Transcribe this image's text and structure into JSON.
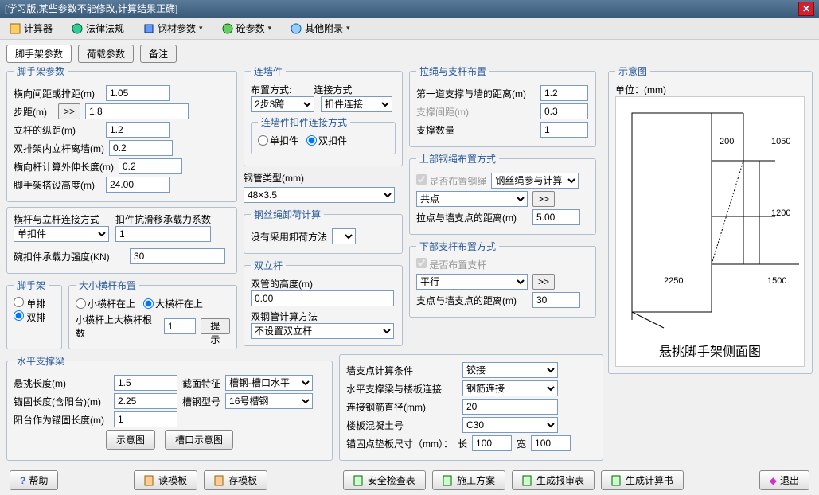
{
  "window": {
    "title": "[学习版,某些参数不能修改,计算结果正确]"
  },
  "toolbar": {
    "calc": "计算器",
    "law": "法律法规",
    "steel": "钢材参数",
    "concrete": "砼参数",
    "other": "其他附录"
  },
  "tabs": {
    "t1": "脚手架参数",
    "t2": "荷载参数",
    "t3": "备注"
  },
  "g_scaffold": {
    "legend": "脚手架参数",
    "l_hgap": "横向间距或排距(m)",
    "v_hgap": "1.05",
    "l_step": "步距(m)",
    "v_step": "1.8",
    "l_lgzj": "立杆的纵距(m)",
    "v_lgzj": "1.2",
    "l_sp_inner": "双排架内立杆离墙(m)",
    "v_sp_inner": "0.2",
    "l_hg_ext": "横向杆计算外伸长度(m)",
    "v_hg_ext": "0.2",
    "l_height": "脚手架搭设高度(m)",
    "v_height": "24.00",
    "l_conn": "横杆与立杆连接方式",
    "v_conn": "单扣件",
    "l_kj": "扣件抗滑移承载力系数",
    "v_kj": "1",
    "l_bowl": "碗扣件承载力强度(KN)",
    "v_bowl": "30",
    "g_jsl": "脚手架",
    "r_single": "单排",
    "r_double": "双排",
    "g_dx": "大小横杆布置",
    "r_xhgs": "小横杆在上",
    "r_dhgs": "大横杆在上",
    "l_xhgsdhg": "小横杆上大横杆根数",
    "v_xhgsdhg": "1",
    "btn_hint": "提示"
  },
  "g_wall": {
    "legend": "连墙件",
    "l_layout": "布置方式:",
    "l_conntype": "连接方式",
    "v_layout": "2步3跨",
    "v_conntype": "扣件连接",
    "g_kjtype": "连墙件扣件连接方式",
    "r_single": "单扣件",
    "r_double": "双扣件",
    "l_pipe": "钢管类型(mm)",
    "v_pipe": "48×3.5",
    "g_wire": "钢丝绳卸荷计算",
    "wire_txt": "没有采用卸荷方法",
    "g_dbl": "双立杆",
    "l_dblh": "双管的高度(m)",
    "v_dblh": "0.00",
    "l_dblm": "双钢管计算方法",
    "v_dblm": "不设置双立杆"
  },
  "g_lashing": {
    "legend": "拉绳与支杆布置",
    "l_first": "第一道支撑与墙的距离(m)",
    "v_first": "1.2",
    "l_spacing": "支撑间距(m)",
    "v_spacing": "0.3",
    "l_count": "支撑数量",
    "v_count": "1",
    "g_top": "上部钢绳布置方式",
    "chk_top": "是否布置钢绳",
    "v_top_sel": "钢丝绳参与计算",
    "v_top_mode": "共点",
    "l_topdist": "拉点与墙支点的距离(m)",
    "v_topdist": "5.00",
    "g_bot": "下部支杆布置方式",
    "chk_bot": "是否布置支杆",
    "v_bot_mode": "平行",
    "l_botdist": "支点与墙支点的距离(m)",
    "v_botdist": "30"
  },
  "g_hbeam": {
    "legend": "水平支撑梁",
    "l_cant": "悬挑长度(m)",
    "v_cant": "1.5",
    "l_sect": "截面特征",
    "v_sect": "槽钢-槽口水平",
    "l_anchor": "锚固长度(含阳台)(m)",
    "v_anchor": "2.25",
    "l_model": "槽钢型号",
    "v_model": "16号槽钢",
    "l_balc": "阳台作为锚固长度(m)",
    "v_balc": "1",
    "btn_diag": "示意图",
    "btn_slot": "槽口示意图"
  },
  "g_wallpt": {
    "l_cond": "墙支点计算条件",
    "v_cond": "铰接",
    "l_conn": "水平支撑梁与楼板连接",
    "v_conn": "钢筋连接",
    "l_dia": "连接钢筋直径(mm)",
    "v_dia": "20",
    "l_conc": "楼板混凝土号",
    "v_conc": "C30",
    "l_pad": "锚固点垫板尺寸（mm）：",
    "l_len": "长",
    "v_len": "100",
    "l_wid": "宽",
    "v_wid": "100"
  },
  "diagram": {
    "legend": "示意图",
    "unit": "单位：(mm)",
    "caption": "悬挑脚手架侧面图",
    "d200": "200",
    "d1050": "1050",
    "d1200": "1200",
    "d2250": "2250",
    "d1500": "1500"
  },
  "footer": {
    "help": "帮助",
    "read": "读模板",
    "save": "存模板",
    "safety": "安全检查表",
    "plan": "施工方案",
    "rpt": "生成报审表",
    "calc": "生成计算书",
    "exit": "退出"
  }
}
